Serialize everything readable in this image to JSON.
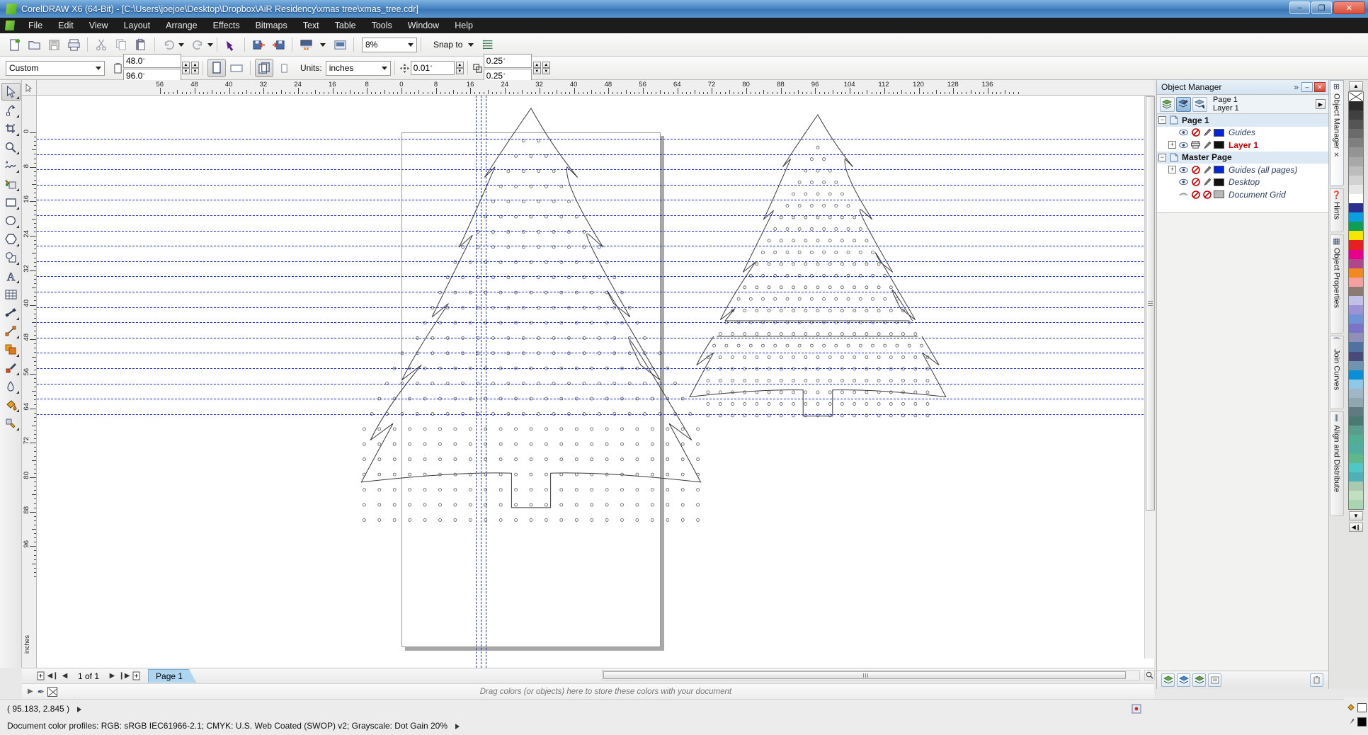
{
  "window": {
    "title": "CorelDRAW X6 (64-Bit) - [C:\\Users\\joejoe\\Desktop\\Dropbox\\AiR Residency\\xmas tree\\xmas_tree.cdr]",
    "minimize_label": "–",
    "maximize_label": "❐",
    "close_label": "✕"
  },
  "menu": {
    "items": [
      "File",
      "Edit",
      "View",
      "Layout",
      "Arrange",
      "Effects",
      "Bitmaps",
      "Text",
      "Table",
      "Tools",
      "Window",
      "Help"
    ]
  },
  "toolbar": {
    "buttons": [
      {
        "name": "new-document",
        "glyph": "📄"
      },
      {
        "name": "open-document",
        "glyph": "📂"
      },
      {
        "name": "save-document",
        "glyph": "💾"
      },
      {
        "name": "print-document",
        "glyph": "🖨"
      },
      {
        "name": "cut",
        "glyph": "✂"
      },
      {
        "name": "copy",
        "glyph": "⧉"
      },
      {
        "name": "paste",
        "glyph": "📋"
      },
      {
        "name": "undo",
        "glyph": "↶"
      },
      {
        "name": "redo",
        "glyph": "↷"
      },
      {
        "name": "corel-connect",
        "glyph": "⬊"
      },
      {
        "name": "import",
        "glyph": "⬇"
      },
      {
        "name": "export",
        "glyph": "⬆"
      },
      {
        "name": "publish-to-pdf",
        "glyph": "▤"
      },
      {
        "name": "application-launcher",
        "glyph": "▣"
      }
    ],
    "zoom_level": "8%",
    "snap_to_label": "Snap to",
    "options_label": "Options"
  },
  "propertybar": {
    "page_preset": "Custom",
    "page_width": "48.0",
    "page_height": "96.0",
    "unit_mark": "\"",
    "orientation_portrait": "portrait",
    "orientation_landscape": "landscape",
    "units_label": "Units:",
    "units_value": "inches",
    "nudge_value": "0.01",
    "duplicate_x": "0.25",
    "duplicate_y": "0.25"
  },
  "toolbox": {
    "tools": [
      {
        "name": "pick-tool",
        "glyph": "➤",
        "active": true
      },
      {
        "name": "shape-tool",
        "glyph": "✐"
      },
      {
        "name": "crop-tool",
        "glyph": "✀"
      },
      {
        "name": "zoom-tool",
        "glyph": "🔍"
      },
      {
        "name": "freehand-tool",
        "glyph": "∿"
      },
      {
        "name": "smart-fill-tool",
        "glyph": "◩"
      },
      {
        "name": "rectangle-tool",
        "glyph": "▭"
      },
      {
        "name": "ellipse-tool",
        "glyph": "◯"
      },
      {
        "name": "polygon-tool",
        "glyph": "⬡"
      },
      {
        "name": "basic-shapes-tool",
        "glyph": "◔"
      },
      {
        "name": "text-tool",
        "glyph": "A"
      },
      {
        "name": "table-tool",
        "glyph": "▦"
      },
      {
        "name": "dimension-tool",
        "glyph": "↔"
      },
      {
        "name": "connector-tool",
        "glyph": "↗"
      },
      {
        "name": "blend-tool",
        "glyph": "◰"
      },
      {
        "name": "color-eyedropper-tool",
        "glyph": "💉"
      },
      {
        "name": "outline-tool",
        "glyph": "✎"
      },
      {
        "name": "fill-tool",
        "glyph": "◱"
      },
      {
        "name": "interactive-fill-tool",
        "glyph": "◆"
      }
    ]
  },
  "rulers": {
    "horizontal_labels": [
      "56",
      "48",
      "40",
      "32",
      "24",
      "16",
      "8",
      "0",
      "8",
      "16",
      "24",
      "32",
      "40",
      "48",
      "56",
      "64",
      "72",
      "80",
      "88",
      "96",
      "104",
      "112",
      "120",
      "128",
      "136"
    ],
    "vertical_labels": [
      "0",
      "8",
      "16",
      "24",
      "32",
      "40",
      "48",
      "56",
      "64",
      "72",
      "80",
      "88",
      "96"
    ],
    "unit_corner": "inches"
  },
  "canvas": {
    "document_name": "xmas_tree.cdr",
    "objects": [
      {
        "name": "christmas-tree-left",
        "description": "Christmas tree cut pattern with perforated dot rows, on page"
      },
      {
        "name": "christmas-tree-right",
        "description": "Christmas tree cut pattern split into two stacked halves, off page"
      }
    ],
    "guides_color": "#1d2fd0"
  },
  "pagebar": {
    "first_page_label": "◀❙",
    "prev_page_label": "◀",
    "next_page_label": "▶",
    "last_page_label": "❙▶",
    "add_page_before_label": "+",
    "add_page_after_label": "+",
    "page_counter": "1 of 1",
    "tabs": [
      "Page 1"
    ]
  },
  "palette_bar": {
    "hint": "Drag colors (or objects) here to store these colors with your document",
    "nav_glyph": "▶",
    "eyedropper_glyph": "✒",
    "no_color_name": "no-color-swatch"
  },
  "statusbar": {
    "cursor_position": "( 95.183, 2.845 )",
    "color_profiles": "Document color profiles: RGB: sRGB IEC61966-2.1; CMYK: U.S. Web Coated (SWOP) v2; Grayscale: Dot Gain 20%"
  },
  "docker": {
    "title": "Object Manager",
    "chevron": "»",
    "minimize": "–",
    "close": "✕",
    "tool_buttons": [
      {
        "name": "show-object-properties",
        "glyph": "⊞"
      },
      {
        "name": "edit-across-layers",
        "glyph": "⊟",
        "selected": true
      },
      {
        "name": "layer-manager-view",
        "glyph": "⊠"
      }
    ],
    "context_page": "Page 1",
    "context_layer": "Layer 1",
    "options_glyph": "▶",
    "tree": [
      {
        "name": "page-1",
        "label": "Page 1",
        "type": "group",
        "expander": "−",
        "style": "bold",
        "indent": 0
      },
      {
        "name": "page-1-guides",
        "label": "Guides",
        "type": "layer",
        "expander": "",
        "style": "italic",
        "swatch": "#0026d6",
        "indent": 1
      },
      {
        "name": "page-1-layer-1",
        "label": "Layer 1",
        "type": "layer",
        "expander": "+",
        "style": "red",
        "swatch": "#111111",
        "indent": 1
      },
      {
        "name": "master-page",
        "label": "Master Page",
        "type": "group",
        "expander": "−",
        "style": "bold",
        "indent": 0
      },
      {
        "name": "master-guides-all-pages",
        "label": "Guides (all pages)",
        "type": "layer",
        "expander": "+",
        "style": "italic",
        "swatch": "#0026d6",
        "indent": 1
      },
      {
        "name": "master-desktop",
        "label": "Desktop",
        "type": "layer",
        "expander": "",
        "style": "italic",
        "swatch": "#111111",
        "indent": 1
      },
      {
        "name": "master-document-grid",
        "label": "Document Grid",
        "type": "layer",
        "expander": "",
        "style": "italic",
        "swatch": "#b8b8b8",
        "indent": 1
      }
    ],
    "footer_buttons": [
      {
        "name": "new-layer-button",
        "glyph": "⊕"
      },
      {
        "name": "new-master-layer-button",
        "glyph": "⊞"
      },
      {
        "name": "new-master-layer-odd-button",
        "glyph": "⊟"
      },
      {
        "name": "layer-properties-button",
        "glyph": "≡"
      },
      {
        "name": "delete-layer-button",
        "glyph": "🗑"
      }
    ]
  },
  "docker_tabs": [
    {
      "name": "tab-object-manager",
      "label": "Object Manager",
      "glyph": "⊞",
      "selected": true,
      "close": "✕"
    },
    {
      "name": "tab-hints",
      "label": "Hints",
      "glyph": "❓"
    },
    {
      "name": "tab-object-properties",
      "label": "Object Properties",
      "glyph": "▦"
    },
    {
      "name": "tab-join-curves",
      "label": "Join Curves",
      "glyph": "⁀"
    },
    {
      "name": "tab-align-and-distribute",
      "label": "Align and Distribute",
      "glyph": "⫼"
    }
  ],
  "color_palette": {
    "scroll_up": "▲",
    "scroll_down": "▼",
    "scroll_end": "◀❙",
    "colors": [
      "#2b2b2b",
      "#404040",
      "#555555",
      "#6b6b6b",
      "#7f7f7f",
      "#949494",
      "#a8a8a8",
      "#bdbdbd",
      "#d2d2d2",
      "#e6e6e6",
      "#ffffff",
      "#2b2f8f",
      "#0aa0e0",
      "#0e9e56",
      "#f5e600",
      "#e62020",
      "#e6008c",
      "#b0468c",
      "#f08a20",
      "#f5a0a0",
      "#8c7a70",
      "#c0c0e8",
      "#9b93d6",
      "#6f93d6",
      "#7b74c6",
      "#8f8fb8",
      "#4f72a0",
      "#4a4a78",
      "#6f93b0",
      "#0a8fd6",
      "#8fc7e6",
      "#a0b8c6",
      "#8fa8b0",
      "#5f7a80",
      "#4a7a74",
      "#589e8c",
      "#4fae93",
      "#4faea0",
      "#5fb88c",
      "#4fc7c7",
      "#4fb0b8",
      "#a8cbb0",
      "#c0e0c0",
      "#a8d6b0"
    ],
    "fill_color": "#ffffff",
    "outline_color": "#000000"
  }
}
